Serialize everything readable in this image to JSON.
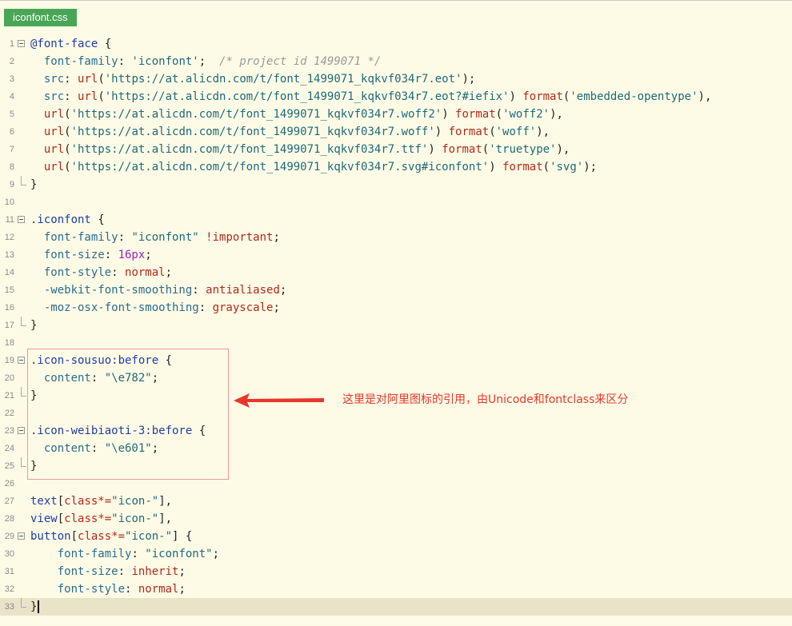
{
  "tab": {
    "title": "iconfont.css"
  },
  "annotation": {
    "text": "这里是对阿里图标的引用，由Unicode和fontclass来区分",
    "color": "#e8372a"
  },
  "colors": {
    "accent": "#49a656",
    "annotation_box": "#ea9a9a"
  },
  "lines": [
    {
      "n": "1",
      "fold": "open",
      "tokens": [
        [
          "sel",
          "@font-face"
        ],
        [
          "t",
          " {"
        ]
      ]
    },
    {
      "n": "2",
      "tokens": [
        [
          "p",
          "  font-family"
        ],
        [
          "t",
          ": "
        ],
        [
          "s",
          "'iconfont'"
        ],
        [
          "t",
          ";  "
        ],
        [
          "c",
          "/* project id 1499071 */"
        ]
      ]
    },
    {
      "n": "3",
      "tokens": [
        [
          "p",
          "  src"
        ],
        [
          "t",
          ": "
        ],
        [
          "f",
          "url"
        ],
        [
          "t",
          "("
        ],
        [
          "s",
          "'https://at.alicdn.com/t/font_1499071_kqkvf034r7.eot'"
        ],
        [
          "t",
          ");"
        ]
      ]
    },
    {
      "n": "4",
      "tokens": [
        [
          "p",
          "  src"
        ],
        [
          "t",
          ": "
        ],
        [
          "f",
          "url"
        ],
        [
          "t",
          "("
        ],
        [
          "s",
          "'https://at.alicdn.com/t/font_1499071_kqkvf034r7.eot?#iefix'"
        ],
        [
          "t",
          ") "
        ],
        [
          "f",
          "format"
        ],
        [
          "t",
          "("
        ],
        [
          "s",
          "'embedded-opentype'"
        ],
        [
          "t",
          "),"
        ]
      ]
    },
    {
      "n": "5",
      "tokens": [
        [
          "f",
          "  url"
        ],
        [
          "t",
          "("
        ],
        [
          "s",
          "'https://at.alicdn.com/t/font_1499071_kqkvf034r7.woff2'"
        ],
        [
          "t",
          ") "
        ],
        [
          "f",
          "format"
        ],
        [
          "t",
          "("
        ],
        [
          "s",
          "'woff2'"
        ],
        [
          "t",
          "),"
        ]
      ]
    },
    {
      "n": "6",
      "tokens": [
        [
          "f",
          "  url"
        ],
        [
          "t",
          "("
        ],
        [
          "s",
          "'https://at.alicdn.com/t/font_1499071_kqkvf034r7.woff'"
        ],
        [
          "t",
          ") "
        ],
        [
          "f",
          "format"
        ],
        [
          "t",
          "("
        ],
        [
          "s",
          "'woff'"
        ],
        [
          "t",
          "),"
        ]
      ]
    },
    {
      "n": "7",
      "tokens": [
        [
          "f",
          "  url"
        ],
        [
          "t",
          "("
        ],
        [
          "s",
          "'https://at.alicdn.com/t/font_1499071_kqkvf034r7.ttf'"
        ],
        [
          "t",
          ") "
        ],
        [
          "f",
          "format"
        ],
        [
          "t",
          "("
        ],
        [
          "s",
          "'truetype'"
        ],
        [
          "t",
          "),"
        ]
      ]
    },
    {
      "n": "8",
      "tokens": [
        [
          "f",
          "  url"
        ],
        [
          "t",
          "("
        ],
        [
          "s",
          "'https://at.alicdn.com/t/font_1499071_kqkvf034r7.svg#iconfont'"
        ],
        [
          "t",
          ") "
        ],
        [
          "f",
          "format"
        ],
        [
          "t",
          "("
        ],
        [
          "s",
          "'svg'"
        ],
        [
          "t",
          ");"
        ]
      ]
    },
    {
      "n": "9",
      "fold": "end",
      "tokens": [
        [
          "t",
          "}"
        ]
      ]
    },
    {
      "n": "10",
      "tokens": []
    },
    {
      "n": "11",
      "fold": "open",
      "tokens": [
        [
          "sel",
          ".iconfont"
        ],
        [
          "t",
          " {"
        ]
      ]
    },
    {
      "n": "12",
      "tokens": [
        [
          "p",
          "  font-family"
        ],
        [
          "t",
          ": "
        ],
        [
          "s",
          "\"iconfont\""
        ],
        [
          "t",
          " "
        ],
        [
          "red",
          "!important"
        ],
        [
          "t",
          ";"
        ]
      ]
    },
    {
      "n": "13",
      "tokens": [
        [
          "p",
          "  font-size"
        ],
        [
          "t",
          ": "
        ],
        [
          "n",
          "16px"
        ],
        [
          "t",
          ";"
        ]
      ]
    },
    {
      "n": "14",
      "tokens": [
        [
          "p",
          "  font-style"
        ],
        [
          "t",
          ": "
        ],
        [
          "red",
          "normal"
        ],
        [
          "t",
          ";"
        ]
      ]
    },
    {
      "n": "15",
      "tokens": [
        [
          "p",
          "  -webkit-font-smoothing"
        ],
        [
          "t",
          ": "
        ],
        [
          "red",
          "antialiased"
        ],
        [
          "t",
          ";"
        ]
      ]
    },
    {
      "n": "16",
      "tokens": [
        [
          "p",
          "  -moz-osx-font-smoothing"
        ],
        [
          "t",
          ": "
        ],
        [
          "red",
          "grayscale"
        ],
        [
          "t",
          ";"
        ]
      ]
    },
    {
      "n": "17",
      "fold": "end",
      "tokens": [
        [
          "t",
          "}"
        ]
      ]
    },
    {
      "n": "18",
      "tokens": []
    },
    {
      "n": "19",
      "fold": "open",
      "tokens": [
        [
          "sel",
          ".icon-sousuo:before"
        ],
        [
          "t",
          " {"
        ]
      ]
    },
    {
      "n": "20",
      "tokens": [
        [
          "p",
          "  content"
        ],
        [
          "t",
          ": "
        ],
        [
          "s",
          "\"\\e782\""
        ],
        [
          "t",
          ";"
        ]
      ]
    },
    {
      "n": "21",
      "fold": "end",
      "tokens": [
        [
          "t",
          "}"
        ]
      ]
    },
    {
      "n": "22",
      "tokens": []
    },
    {
      "n": "23",
      "fold": "open",
      "tokens": [
        [
          "sel",
          ".icon-weibiaoti-3:before"
        ],
        [
          "t",
          " {"
        ]
      ]
    },
    {
      "n": "24",
      "tokens": [
        [
          "p",
          "  content"
        ],
        [
          "t",
          ": "
        ],
        [
          "s",
          "\"\\e601\""
        ],
        [
          "t",
          ";"
        ]
      ]
    },
    {
      "n": "25",
      "fold": "end",
      "tokens": [
        [
          "t",
          "}"
        ]
      ]
    },
    {
      "n": "26",
      "tokens": []
    },
    {
      "n": "27",
      "tokens": [
        [
          "sel",
          "text"
        ],
        [
          "t",
          "["
        ],
        [
          "red",
          "class*="
        ],
        [
          "s",
          "\"icon-\""
        ],
        [
          "t",
          "],"
        ]
      ]
    },
    {
      "n": "28",
      "tokens": [
        [
          "sel",
          "view"
        ],
        [
          "t",
          "["
        ],
        [
          "red",
          "class*="
        ],
        [
          "s",
          "\"icon-\""
        ],
        [
          "t",
          "],"
        ]
      ]
    },
    {
      "n": "29",
      "fold": "open",
      "tokens": [
        [
          "sel",
          "button"
        ],
        [
          "t",
          "["
        ],
        [
          "red",
          "class*="
        ],
        [
          "s",
          "\"icon-\""
        ],
        [
          "t",
          "] {"
        ]
      ]
    },
    {
      "n": "30",
      "tokens": [
        [
          "p",
          "    font-family"
        ],
        [
          "t",
          ": "
        ],
        [
          "s",
          "\"iconfont\""
        ],
        [
          "t",
          ";"
        ]
      ]
    },
    {
      "n": "31",
      "tokens": [
        [
          "p",
          "    font-size"
        ],
        [
          "t",
          ": "
        ],
        [
          "red",
          "inherit"
        ],
        [
          "t",
          ";"
        ]
      ]
    },
    {
      "n": "32",
      "tokens": [
        [
          "p",
          "    font-style"
        ],
        [
          "t",
          ": "
        ],
        [
          "red",
          "normal"
        ],
        [
          "t",
          ";"
        ]
      ]
    },
    {
      "n": "33",
      "fold": "end",
      "current": true,
      "tokens": [
        [
          "t",
          "}"
        ]
      ]
    }
  ]
}
